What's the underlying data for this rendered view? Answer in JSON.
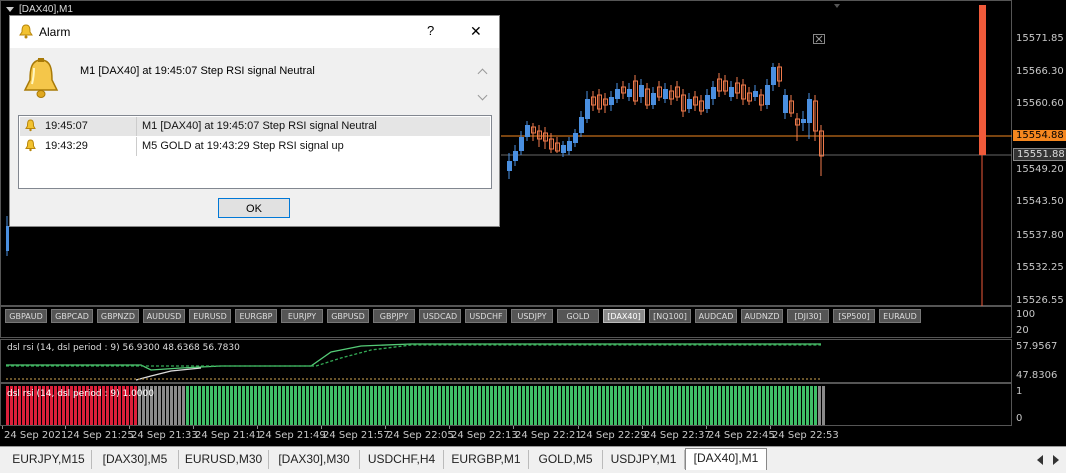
{
  "window": {
    "title": "[DAX40],M1"
  },
  "price_axis": [
    "15571.85",
    "15566.30",
    "15560.60",
    "15554.88",
    "15551.88",
    "15549.20",
    "15543.50",
    "15537.80",
    "15532.25",
    "15526.55"
  ],
  "symbols": [
    "GBPAUD",
    "GBPCAD",
    "GBPNZD",
    "AUDUSD",
    "EURUSD",
    "EURGBP",
    "EURJPY",
    "GBPUSD",
    "GBPJPY",
    "USDCAD",
    "USDCHF",
    "USDJPY",
    "GOLD",
    "[DAX40]",
    "[NQ100]",
    "AUDCAD",
    "AUDNZD",
    "[DJI30]",
    "[SP500]",
    "EURAUD"
  ],
  "dsl_panel": {
    "label": "dsl rsi (14, dsl period : 9) 56.9300 48.6368 56.7830",
    "axis": [
      "100",
      "20",
      "57.9567",
      "47.8306"
    ]
  },
  "histogram": {
    "label": "dsl rsi (14, dsl period : 9) 1.0000",
    "axis": [
      "1",
      "0"
    ]
  },
  "time_axis": [
    "24 Sep 2021",
    "24 Sep 21:25",
    "24 Sep 21:33",
    "24 Sep 21:41",
    "24 Sep 21:49",
    "24 Sep 21:57",
    "24 Sep 22:05",
    "24 Sep 22:13",
    "24 Sep 22:21",
    "24 Sep 22:29",
    "24 Sep 22:37",
    "24 Sep 22:45",
    "24 Sep 22:53"
  ],
  "tabs": [
    "EURJPY,M15",
    "[DAX30],M5",
    "EURUSD,M30",
    "[DAX30],M30",
    "USDCHF,H4",
    "EURGBP,M1",
    "GOLD,M5",
    "USDJPY,M1",
    "[DAX40],M1"
  ],
  "dialog": {
    "title": "Alarm",
    "help": "?",
    "close": "✕",
    "message": "M1 [DAX40] at 19:45:07  Step RSI  signal Neutral",
    "rows": [
      {
        "time": "19:45:07",
        "text": "M1 [DAX40] at 19:45:07  Step RSI  signal Neutral"
      },
      {
        "time": "19:43:29",
        "text": "M5 GOLD at 19:43:29  Step RSI  signal up"
      }
    ],
    "ok": "OK"
  },
  "colors": {
    "up": "#4a8fe0",
    "down": "#ef7a4b",
    "hist_red": "#dc1f3a",
    "hist_green": "#3fbf67",
    "hist_gray": "#8a8a8a",
    "dsl_line": "#55cc77",
    "marker": "#f05a3a"
  }
}
